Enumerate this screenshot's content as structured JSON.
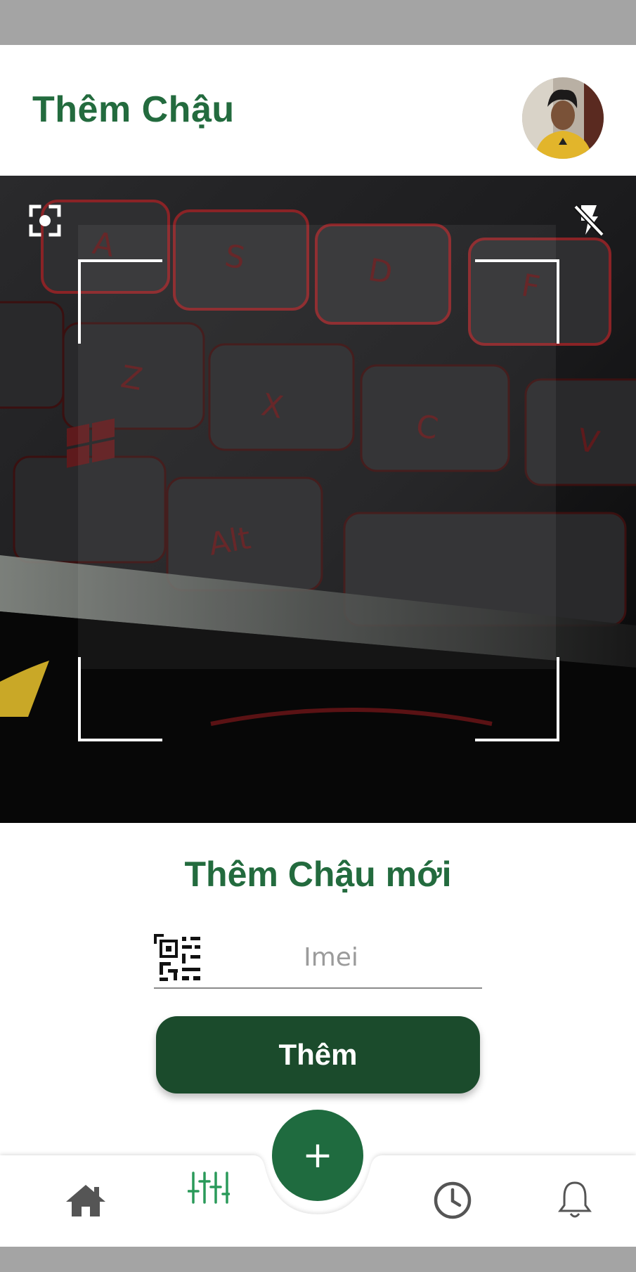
{
  "header": {
    "title": "Thêm Chậu"
  },
  "camera": {
    "focus_icon": "focus-icon",
    "flash_icon": "flash-off-icon"
  },
  "form": {
    "title": "Thêm Chậu mới",
    "imei": {
      "placeholder": "Imei",
      "value": "",
      "icon": "qr-code-icon"
    },
    "submit_label": "Thêm"
  },
  "bottom_nav": {
    "items": [
      "home-icon",
      "sliders-icon",
      "clock-icon",
      "bell-icon"
    ],
    "active": "sliders-icon",
    "fab_icon": "+"
  },
  "colors": {
    "primary": "#236b3e",
    "button": "#1b4b2c",
    "fab": "#1f6b3f",
    "nav_active": "#2a9a5a",
    "nav_inactive": "#555555",
    "system_bar": "#a4a4a4"
  }
}
